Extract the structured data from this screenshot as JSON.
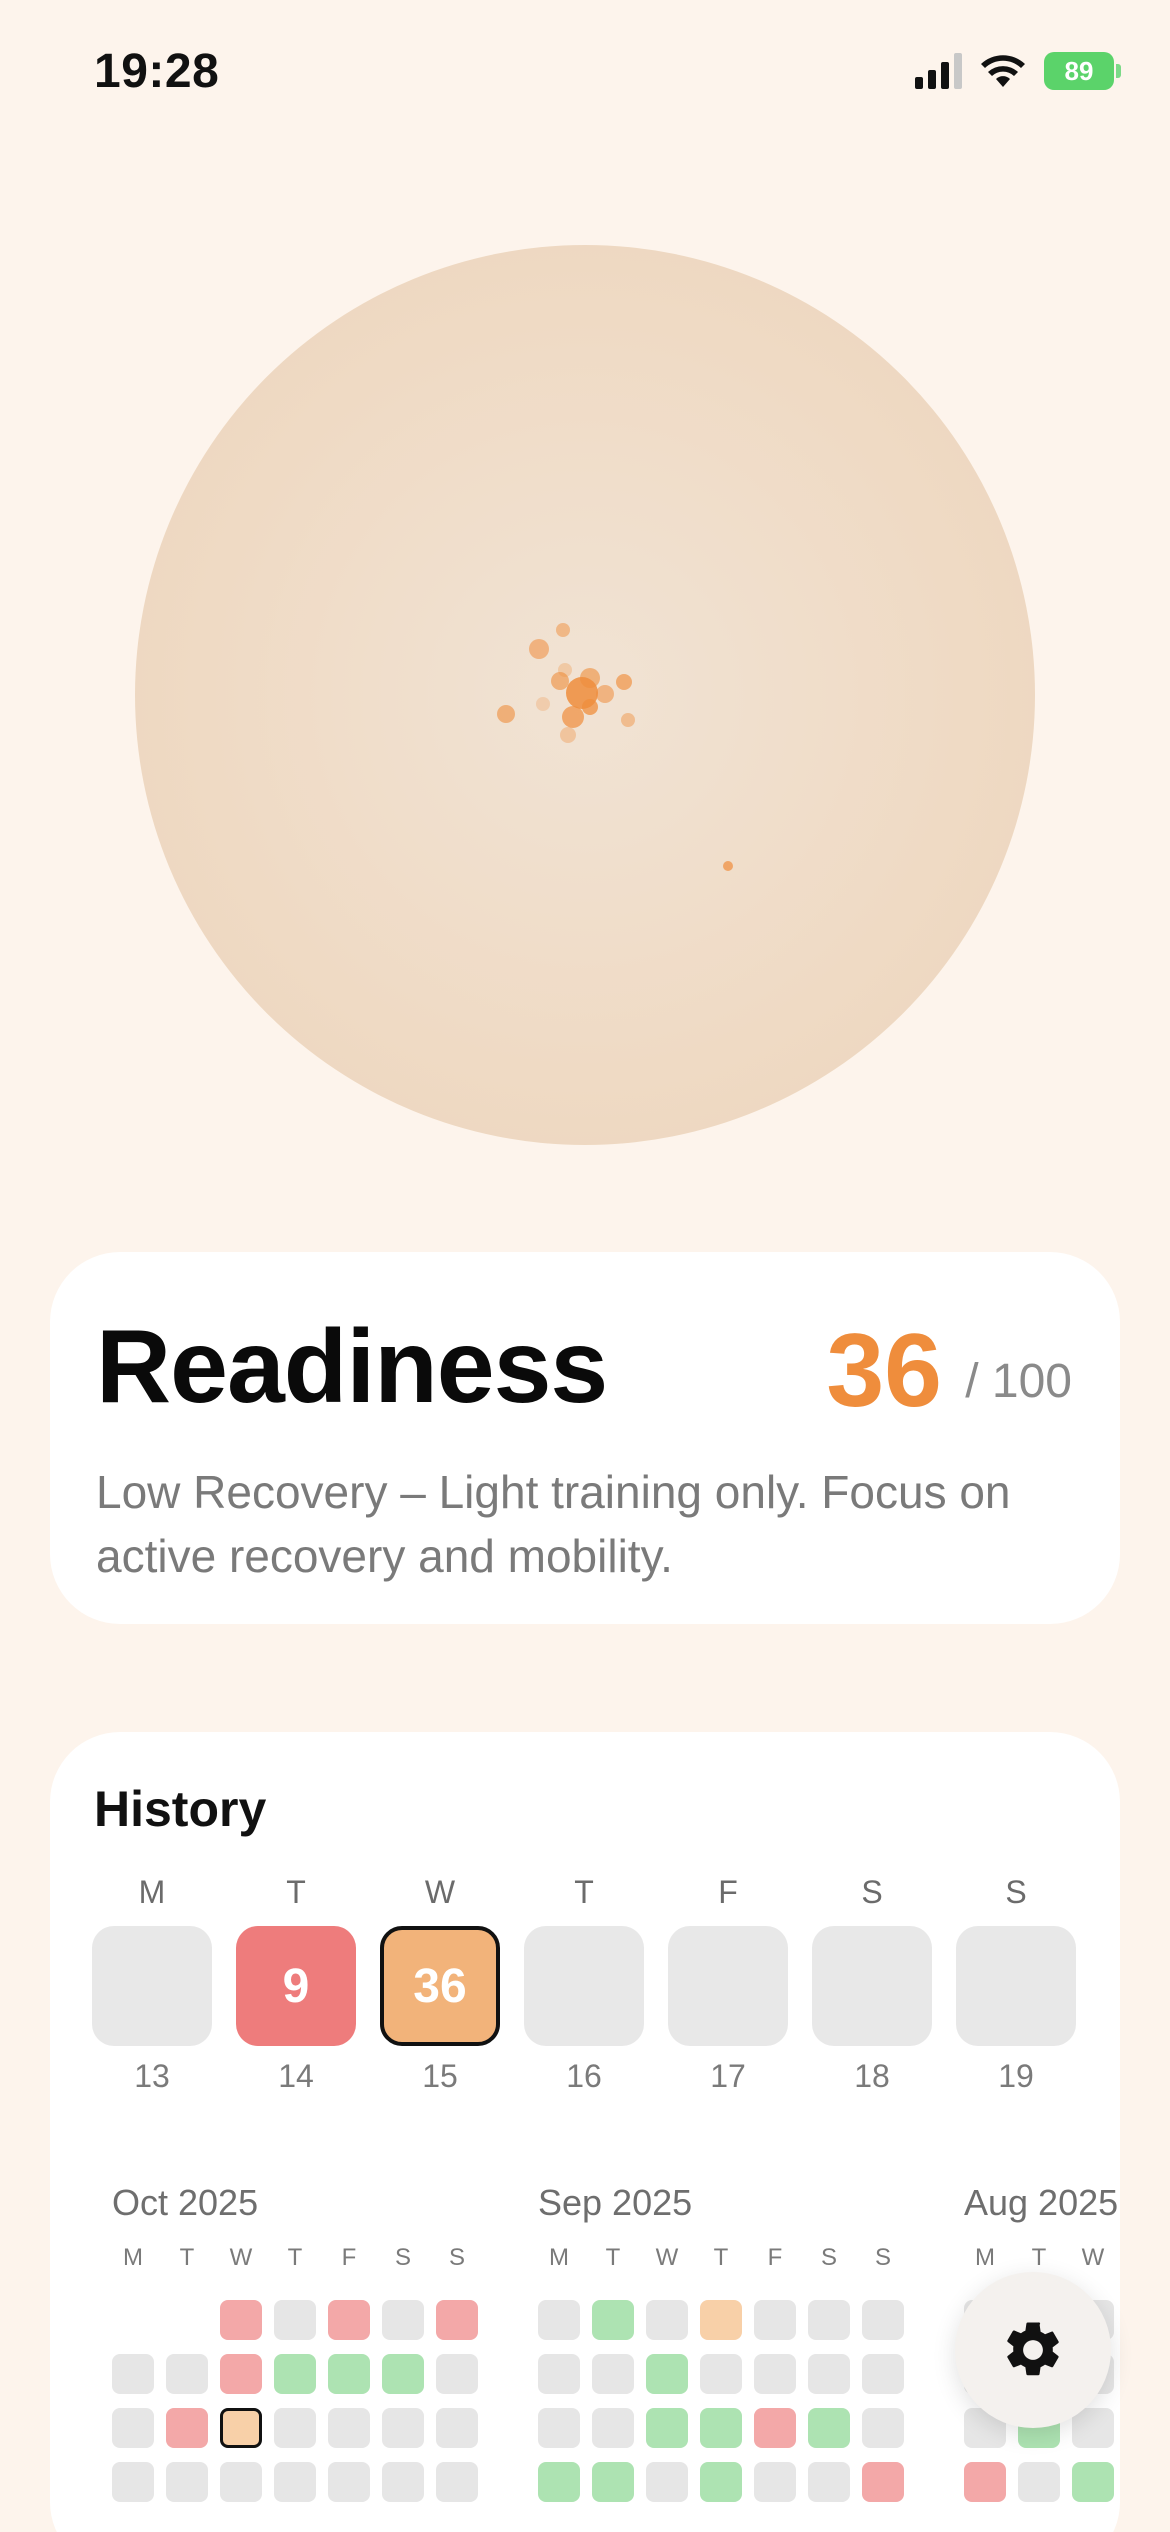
{
  "status_bar": {
    "time": "19:28",
    "battery": "89"
  },
  "readiness": {
    "title": "Readiness",
    "score": "36",
    "max": "/ 100",
    "description": "Low Recovery – Light training only. Focus on active recovery and mobility."
  },
  "history": {
    "title": "History",
    "week": [
      {
        "letter": "M",
        "day": "13",
        "value": "",
        "status": "none"
      },
      {
        "letter": "T",
        "day": "14",
        "value": "9",
        "status": "low"
      },
      {
        "letter": "W",
        "day": "15",
        "value": "36",
        "status": "medium-selected"
      },
      {
        "letter": "T",
        "day": "16",
        "value": "",
        "status": "none"
      },
      {
        "letter": "F",
        "day": "17",
        "value": "",
        "status": "none"
      },
      {
        "letter": "S",
        "day": "18",
        "value": "",
        "status": "none"
      },
      {
        "letter": "S",
        "day": "19",
        "value": "",
        "status": "none"
      }
    ],
    "dow_letters": [
      "M",
      "T",
      "W",
      "T",
      "F",
      "S",
      "S"
    ],
    "months": [
      {
        "label": "Oct 2025",
        "weeks": [
          [
            "empty",
            "empty",
            "red",
            "gray",
            "red",
            "gray",
            "red"
          ],
          [
            "gray",
            "gray",
            "red",
            "green",
            "green",
            "green",
            "gray"
          ],
          [
            "gray",
            "red",
            "orange-selected",
            "gray",
            "gray",
            "gray",
            "gray"
          ],
          [
            "gray",
            "gray",
            "gray",
            "gray",
            "gray",
            "gray",
            "gray"
          ]
        ]
      },
      {
        "label": "Sep 2025",
        "weeks": [
          [
            "gray",
            "green",
            "gray",
            "orange",
            "gray",
            "gray",
            "gray"
          ],
          [
            "gray",
            "gray",
            "green",
            "gray",
            "gray",
            "gray",
            "gray"
          ],
          [
            "gray",
            "gray",
            "green",
            "green",
            "red",
            "green",
            "gray"
          ],
          [
            "green",
            "green",
            "gray",
            "green",
            "gray",
            "gray",
            "red"
          ]
        ]
      },
      {
        "label": "Aug 2025",
        "weeks": [
          [
            "gray",
            "gray",
            "gray",
            "gray",
            "gray",
            "gray",
            "gray"
          ],
          [
            "gray",
            "gray",
            "gray",
            "gray",
            "gray",
            "gray",
            "gray"
          ],
          [
            "gray",
            "green",
            "gray",
            "gray",
            "gray",
            "gray",
            "gray"
          ],
          [
            "red",
            "gray",
            "green",
            "gray",
            "gray",
            "gray",
            "gray"
          ]
        ]
      }
    ]
  },
  "colors": {
    "accent": "#ef8d3c",
    "low": "#ee7c7c",
    "medium": "#f2b37a",
    "good": "#a9dfae",
    "neutral": "#e8e8e8"
  },
  "icons": {
    "settings": "gear-icon",
    "signal": "signal-icon",
    "wifi": "wifi-icon",
    "battery": "battery-icon"
  }
}
